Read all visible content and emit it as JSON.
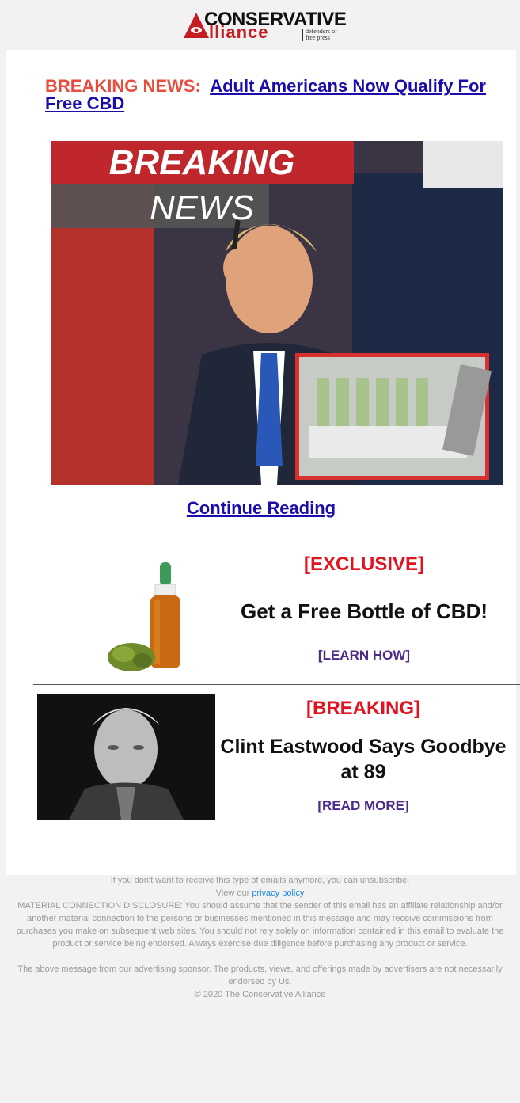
{
  "logo": {
    "line1": "CONSERVATIVE",
    "line2": "lliance",
    "tagline": "defenders of free press",
    "mark": "A"
  },
  "headline": {
    "label": "BREAKING NEWS:",
    "link": "Adult Americans Now Qualify For Free CBD"
  },
  "hero": {
    "banner_top": "BREAKING",
    "banner_bottom": "NEWS"
  },
  "continue_label": "Continue Reading",
  "ad1": {
    "tag": "[EXCLUSIVE]",
    "title": "Get a Free Bottle of CBD!",
    "cta": "[LEARN HOW]"
  },
  "ad2": {
    "tag": "[BREAKING]",
    "title": "Clint Eastwood Says Goodbye at 89",
    "cta": "[READ MORE]"
  },
  "footer": {
    "unsubscribe": "If you don't want to receive this type of emails anymore, you can unsubscribe.",
    "view_prefix": "View our",
    "privacy": "privacy policy",
    "disclosure": "MATERIAL CONNECTION DISCLOSURE: You should assume that the sender of this email has an affiliate relationship and/or another material connection to the persons or businesses mentioned in this message and may receive commissions from purchases you make on subsequent web sites. You should not rely solely on information contained in this email to evaluate the product or service being endorsed. Always exercise due diligence before purchasing any product or service.",
    "sponsor": "The above message from our advertising sponsor. The products, views, and offerings made by advertisers are not necessarily endorsed by Us.",
    "copyright": "© 2020 The Conservative Alliance"
  },
  "colors": {
    "brand_red": "#c61d23",
    "link_blue": "#1a0dab",
    "headline_red": "#e74c3c",
    "cta_purple": "#4b2a8a"
  }
}
